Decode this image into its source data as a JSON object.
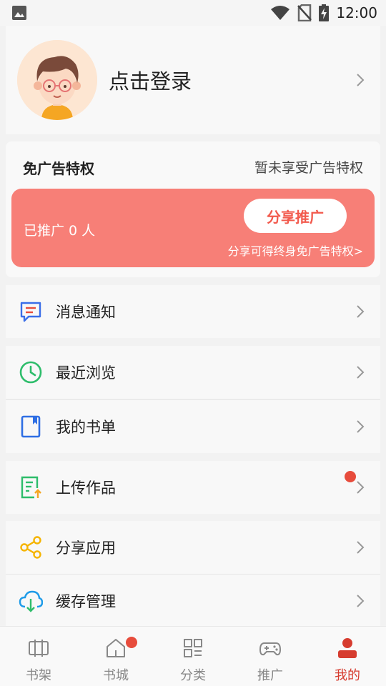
{
  "status": {
    "time": "12:00"
  },
  "profile": {
    "login_text": "点击登录"
  },
  "ad_privilege": {
    "title": "免广告特权",
    "status": "暂未享受广告特权",
    "promoted_count": "已推广 0 人",
    "share_button": "分享推广",
    "note": "分享可得终身免广告特权>"
  },
  "menu": [
    {
      "label": "消息通知",
      "icon": "message-icon"
    },
    {
      "label": "最近浏览",
      "icon": "clock-icon"
    },
    {
      "label": "我的书单",
      "icon": "booklist-icon"
    },
    {
      "label": "上传作品",
      "icon": "upload-doc-icon",
      "badge": true
    },
    {
      "label": "分享应用",
      "icon": "share-icon"
    },
    {
      "label": "缓存管理",
      "icon": "cloud-download-icon"
    }
  ],
  "tabs": [
    {
      "label": "书架",
      "icon": "bookshelf-icon"
    },
    {
      "label": "书城",
      "icon": "home-icon",
      "badge": true
    },
    {
      "label": "分类",
      "icon": "grid-icon"
    },
    {
      "label": "推广",
      "icon": "gamepad-icon"
    },
    {
      "label": "我的",
      "icon": "person-icon",
      "active": true
    }
  ],
  "colors": {
    "promo_bg": "#f77f77",
    "promo_button_text": "#f25a4d",
    "active_tab": "#d63c2f",
    "badge": "#e74c3c"
  }
}
